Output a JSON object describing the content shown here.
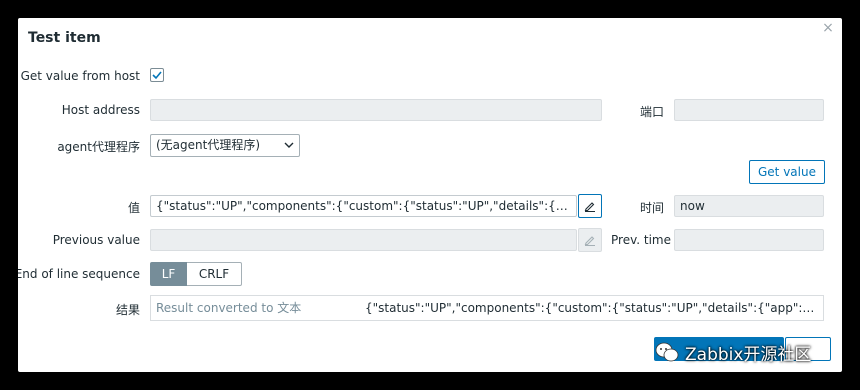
{
  "dialog": {
    "title": "Test item",
    "close_glyph": "×"
  },
  "form": {
    "get_value_from_host_label": "Get value from host",
    "get_value_from_host_checked": true,
    "host_address_label": "Host address",
    "host_address_value": "",
    "port_label": "端口",
    "port_value": "",
    "proxy_label": "agent代理程序",
    "proxy_selected": "(无agent代理程序)",
    "get_value_button": "Get value",
    "value_label": "值",
    "value_value": "{\"status\":\"UP\",\"components\":{\"custom\":{\"status\":\"UP\",\"details\":{\"app\":\"Alive and Kicking\"}}}}",
    "time_label": "时间",
    "time_value": "now",
    "previous_value_label": "Previous value",
    "previous_value": "",
    "prev_time_label": "Prev. time",
    "prev_time_value": "",
    "eol_label": "End of line sequence",
    "eol_options": [
      "LF",
      "CRLF"
    ],
    "eol_selected": "LF",
    "result_label": "结果",
    "result_converted": "Result converted to 文本",
    "result_value": "{\"status\":\"UP\",\"components\":{\"custom\":{\"status\":\"UP\",\"details\":{\"app\":\"Alive and Kicking\"}}}}"
  },
  "watermark": {
    "text": "Zabbix开源社区"
  },
  "colors": {
    "accent": "#0275b8",
    "toggle_active": "#768d99",
    "readonly_bg": "#ebeef0"
  }
}
